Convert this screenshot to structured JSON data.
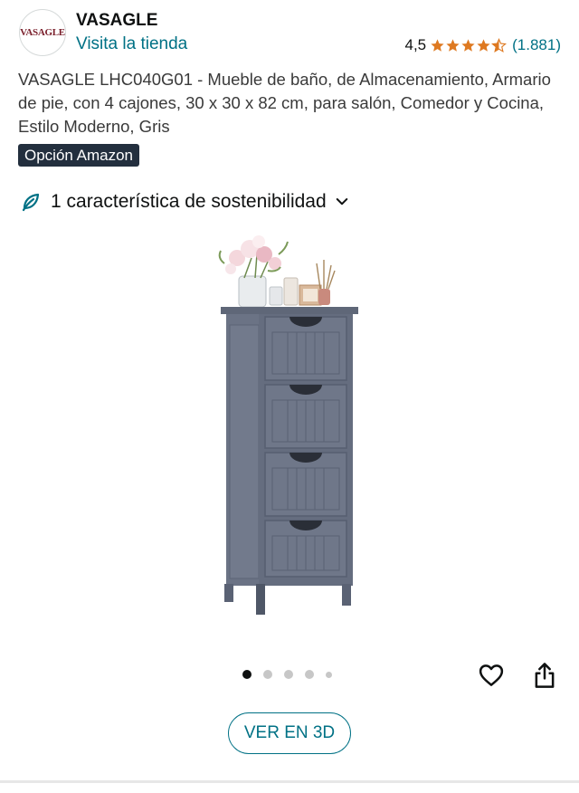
{
  "brand": {
    "logo_text": "VASAGLE",
    "name": "VASAGLE",
    "store_link": "Visita la tienda"
  },
  "rating": {
    "value": "4,5",
    "stars": 4.5,
    "count": "(1.881)",
    "star_color": "#de7921"
  },
  "product": {
    "title": "VASAGLE LHC040G01 - Mueble de baño, de Almacenamiento, Armario de pie, con 4 cajones, 30 x 30 x 82 cm, para salón, Comedor y Cocina, Estilo Moderno, Gris",
    "badge": "Opción Amazon"
  },
  "sustainability": {
    "label": "1 característica de sostenibilidad",
    "icon": "leaf-icon"
  },
  "gallery": {
    "image_count": 5,
    "active_index": 0
  },
  "actions": {
    "wishlist_icon": "heart-icon",
    "share_icon": "share-icon",
    "view_3d_label": "VER EN 3D"
  },
  "colors": {
    "link": "#007185",
    "badge_bg": "#232f3e",
    "cabinet": "#6b7385"
  }
}
